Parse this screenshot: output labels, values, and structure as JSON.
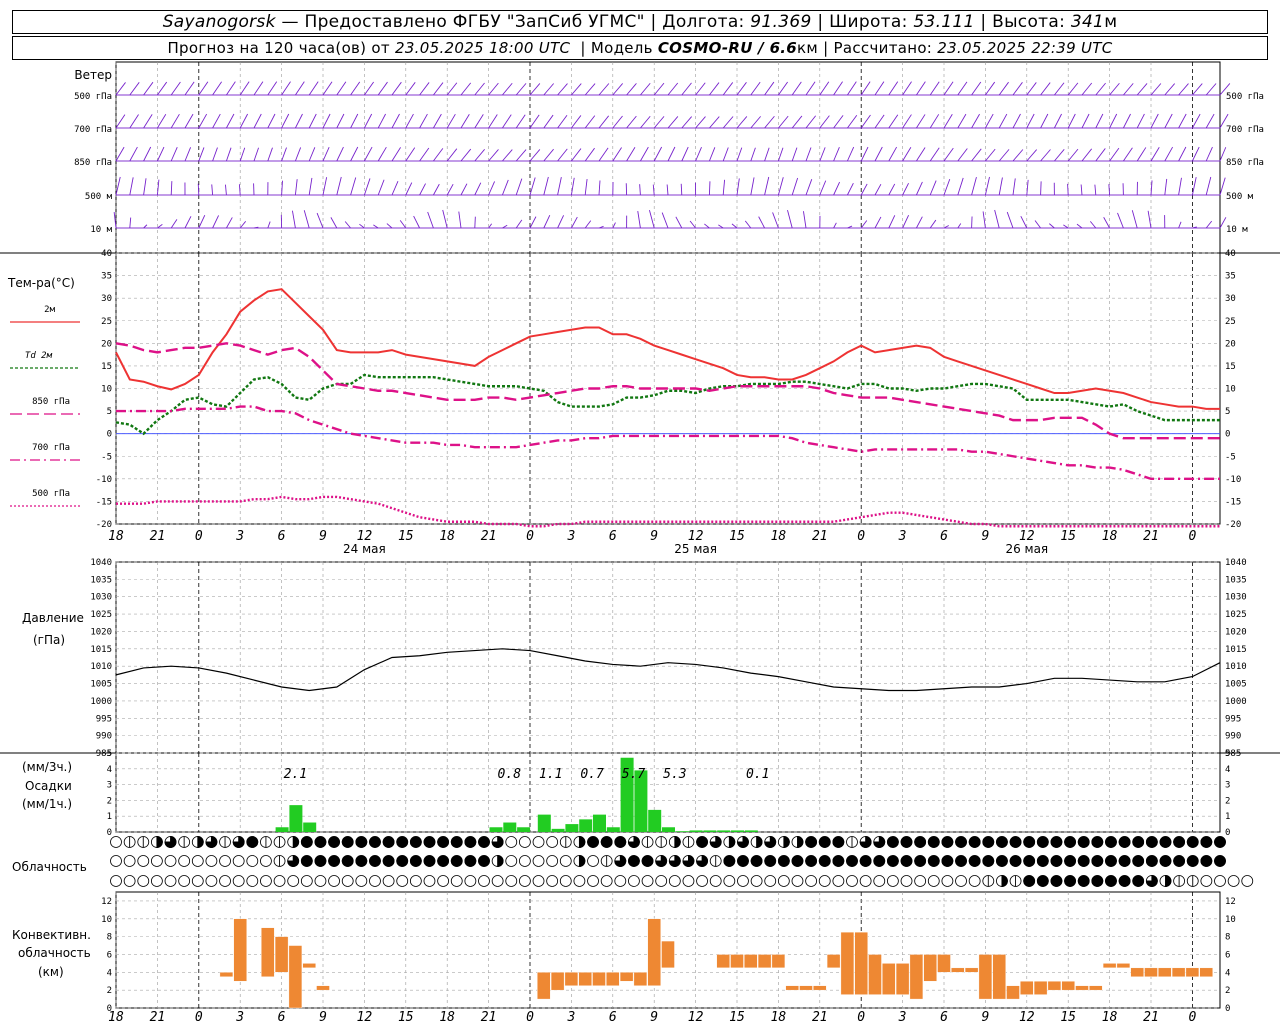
{
  "header": {
    "station": "Sayanogorsk",
    "dash": "—",
    "provider": "Предоставлено ФГБУ \"ЗапСиб УГМС\"",
    "lon_label": "Долгота:",
    "lon_value": "91.369",
    "lat_label": "Широта:",
    "lat_value": "53.111",
    "alt_label": "Высота:",
    "alt_value": "341",
    "alt_unit": "м",
    "sep": "|"
  },
  "subheader": {
    "forecast_prefix": "Прогноз на 120 часа(ов) от",
    "start_time": "23.05.2025 18:00 UTC",
    "model_label": "Модель",
    "model_name": "COSMO-RU / 6.6",
    "model_unit": "км",
    "calc_label": "Рассчитано:",
    "calc_time": "23.05.2025 22:39 UTC",
    "sep": "|"
  },
  "x_axis": {
    "hour_labels": [
      "18",
      "21",
      "0",
      "3",
      "6",
      "9",
      "12",
      "15",
      "18",
      "21",
      "0",
      "3",
      "6",
      "9",
      "12",
      "15",
      "18",
      "21",
      "0",
      "3",
      "6",
      "9",
      "12",
      "15",
      "18",
      "21",
      "0"
    ],
    "day_labels": [
      {
        "text": "24 мая",
        "x": 18
      },
      {
        "text": "25 мая",
        "x": 42
      },
      {
        "text": "26 мая",
        "x": 66
      }
    ]
  },
  "wind": {
    "title": "Ветер",
    "levels": [
      "500 гПа",
      "700 гПа",
      "850 гПа",
      "500 м",
      "10 м"
    ],
    "right_levels": [
      "500 гПа",
      "700 гПа",
      "850 гПа",
      "500 м",
      "10 м"
    ]
  },
  "temperature": {
    "title": "Тем-ра(°C)",
    "legend": [
      {
        "label": "2м",
        "color": "#ee3333",
        "dash": ""
      },
      {
        "label": "Td 2м",
        "color": "#117711",
        "dash": "3,2"
      },
      {
        "label": "850 гПа",
        "color": "#dd1188",
        "dash": "12,5"
      },
      {
        "label": "700 гПа",
        "color": "#dd1188",
        "dash": "10,4,2,4"
      },
      {
        "label": "500 гПа",
        "color": "#dd1188",
        "dash": "2,2"
      }
    ]
  },
  "pressure": {
    "title": "Давление",
    "unit": "(гПа)"
  },
  "precip": {
    "title1": "(мм/3ч.)",
    "title2": "Осадки",
    "title3": "(мм/1ч.)"
  },
  "clouds": {
    "title": "Облачность"
  },
  "convective": {
    "title1": "Конвективн.",
    "title2": "облачность",
    "title3": "(км)"
  },
  "chart_data": [
    {
      "type": "line",
      "title": "Тем-ра(°C)",
      "x": [
        0,
        1,
        2,
        3,
        4,
        5,
        6,
        7,
        8,
        9,
        10,
        11,
        12,
        13,
        14,
        15,
        16,
        17,
        18,
        19,
        20,
        21,
        22,
        23,
        24,
        25,
        26,
        27,
        28,
        29,
        30,
        31,
        32,
        33,
        34,
        35,
        36,
        37,
        38,
        39,
        40,
        41,
        42,
        43,
        44,
        45,
        46,
        47,
        48,
        49,
        50,
        51,
        52,
        53,
        54,
        55,
        56,
        57,
        58,
        59,
        60,
        61,
        62,
        63,
        64,
        65,
        66,
        67,
        68,
        69,
        70,
        71,
        72,
        73,
        74,
        75,
        76,
        77,
        78,
        79,
        80
      ],
      "ylim": [
        -20,
        40
      ],
      "series": [
        {
          "name": "2м",
          "values": [
            18,
            12,
            11.5,
            10.5,
            9.8,
            11,
            13,
            18,
            22,
            27,
            29.5,
            31.5,
            32,
            29,
            26,
            23,
            18.5,
            18,
            18,
            18,
            18.5,
            17.5,
            17,
            16.5,
            16,
            15.5,
            15,
            17,
            18.5,
            20,
            21.5,
            22,
            22.5,
            23,
            23.5,
            23.5,
            22,
            22,
            21,
            19.5,
            18.5,
            17.5,
            16.5,
            15.5,
            14.5,
            13,
            12.5,
            12.5,
            12,
            12,
            13,
            14.5,
            16,
            18,
            19.5,
            18,
            18.5,
            19,
            19.5,
            19,
            17,
            16,
            15,
            14,
            13,
            12,
            11,
            10,
            9,
            9,
            9.5,
            10,
            9.5,
            9,
            8,
            7,
            6.5,
            6,
            6,
            5.5,
            5.5
          ]
        },
        {
          "name": "Td 2м",
          "values": [
            2.5,
            2,
            0,
            3,
            5,
            7.5,
            8,
            6.5,
            6,
            9,
            12,
            12.5,
            11,
            8,
            7.5,
            10,
            11,
            11,
            13,
            12.5,
            12.5,
            12.5,
            12.5,
            12.5,
            12,
            11.5,
            11,
            10.5,
            10.5,
            10.5,
            10,
            9.5,
            7,
            6,
            6,
            6,
            6.5,
            8,
            8,
            8.5,
            9.5,
            9.5,
            9,
            10,
            10.5,
            10.5,
            11,
            11,
            11,
            11.5,
            11.5,
            11,
            10.5,
            10,
            11,
            11,
            10,
            10,
            9.5,
            10,
            10,
            10.5,
            11,
            11,
            10.5,
            10,
            7.5,
            7.5,
            7.5,
            7.5,
            7,
            6.5,
            6,
            6.5,
            5,
            4,
            3,
            3,
            3,
            3,
            3
          ]
        },
        {
          "name": "850 гПа",
          "values": [
            20,
            19.5,
            18.5,
            18,
            18.5,
            19,
            19,
            19.5,
            20,
            19.5,
            18.5,
            17.5,
            18.5,
            19,
            17,
            14,
            11,
            10.5,
            10,
            9.5,
            9.5,
            9,
            8.5,
            8,
            7.5,
            7.5,
            7.5,
            8,
            8,
            7.5,
            8,
            8.5,
            9,
            9.5,
            10,
            10,
            10.5,
            10.5,
            10,
            10,
            10,
            10,
            10,
            9.5,
            10,
            10.5,
            10.5,
            10.5,
            10.5,
            10.5,
            10.5,
            10,
            9,
            8.5,
            8,
            8,
            8,
            7.5,
            7,
            6.5,
            6,
            5.5,
            5,
            4.5,
            4,
            3,
            3,
            3,
            3.5,
            3.5,
            3.5,
            2,
            0,
            -1,
            -1,
            -1,
            -1,
            -1,
            -1,
            -1,
            -1
          ]
        },
        {
          "name": "700 гПа",
          "values": [
            5,
            5,
            5,
            5,
            5,
            5.5,
            5.5,
            5.5,
            5.5,
            6,
            6,
            5,
            5,
            4.5,
            3,
            2,
            1,
            0,
            -0.5,
            -1,
            -1.5,
            -2,
            -2,
            -2,
            -2.5,
            -2.5,
            -3,
            -3,
            -3,
            -3,
            -2.5,
            -2,
            -1.5,
            -1.5,
            -1,
            -1,
            -0.5,
            -0.5,
            -0.5,
            -0.5,
            -0.5,
            -0.5,
            -0.5,
            -0.5,
            -0.5,
            -0.5,
            -0.5,
            -0.5,
            -0.5,
            -1,
            -2,
            -2.5,
            -3,
            -3.5,
            -4,
            -3.5,
            -3.5,
            -3.5,
            -3.5,
            -3.5,
            -3.5,
            -3.5,
            -4,
            -4,
            -4.5,
            -5,
            -5.5,
            -6,
            -6.5,
            -7,
            -7,
            -7.5,
            -7.5,
            -8,
            -9,
            -10,
            -10,
            -10,
            -10,
            -10,
            -10
          ]
        },
        {
          "name": "500 гПа",
          "values": [
            -15.5,
            -15.5,
            -15.5,
            -15,
            -15,
            -15,
            -15,
            -15,
            -15,
            -15,
            -14.5,
            -14.5,
            -14,
            -14.5,
            -14.5,
            -14,
            -14,
            -14.5,
            -15,
            -15.5,
            -16.5,
            -17.5,
            -18.5,
            -19,
            -19.5,
            -19.5,
            -19.5,
            -20,
            -20,
            -20,
            -20.5,
            -20.5,
            -20,
            -20,
            -19.5,
            -19.5,
            -19.5,
            -19.5,
            -19.5,
            -19.5,
            -19.5,
            -19.5,
            -19.5,
            -19.5,
            -19.5,
            -19.5,
            -19.5,
            -19.5,
            -19.5,
            -19.5,
            -19.5,
            -19.5,
            -19.5,
            -19,
            -18.5,
            -18,
            -17.5,
            -17.5,
            -18,
            -18.5,
            -19,
            -19.5,
            -20,
            -20,
            -20.5,
            -20.5,
            -20.5,
            -20.5,
            -20.5,
            -20.5,
            -20.5,
            -20.5,
            -20.5,
            -20.5,
            -20.5,
            -20.5,
            -20.5,
            -20.5,
            -20.5,
            -20.5,
            -20.5
          ]
        }
      ]
    },
    {
      "type": "line",
      "title": "Давление",
      "ylabel": "(гПа)",
      "x": [
        0,
        2,
        4,
        6,
        8,
        10,
        12,
        14,
        16,
        18,
        20,
        22,
        24,
        26,
        28,
        30,
        32,
        34,
        36,
        38,
        40,
        42,
        44,
        46,
        48,
        50,
        52,
        54,
        56,
        58,
        60,
        62,
        64,
        66,
        68,
        70,
        72,
        74,
        76,
        78,
        80
      ],
      "ylim": [
        985,
        1040
      ],
      "series": [
        {
          "name": "",
          "values": [
            1007.5,
            1009.5,
            1010,
            1009.5,
            1008,
            1006,
            1004,
            1003,
            1004,
            1009,
            1012.5,
            1013,
            1014,
            1014.5,
            1015,
            1014.5,
            1013,
            1011.5,
            1010.5,
            1010,
            1011,
            1010.5,
            1009.5,
            1008,
            1007,
            1005.5,
            1004,
            1003.5,
            1003,
            1003,
            1003.5,
            1004,
            1004,
            1005,
            1006.5,
            1006.5,
            1006,
            1005.5,
            1005.5,
            1007,
            1011
          ]
        }
      ]
    },
    {
      "type": "bar",
      "title": "Осадки",
      "ylabel": "(мм/1ч.)",
      "ylim": [
        0,
        5
      ],
      "x_hours": [
        12,
        13,
        14,
        27.5,
        28.5,
        29.5,
        31,
        32,
        33,
        34,
        35,
        36,
        37,
        38,
        39,
        40,
        41,
        42,
        43,
        44,
        45,
        46
      ],
      "values": [
        0.3,
        1.7,
        0.6,
        0.3,
        0.6,
        0.3,
        1.1,
        0.2,
        0.5,
        0.8,
        1.1,
        0.3,
        4.7,
        3.9,
        1.4,
        0.3,
        0.05,
        0.1,
        0.1,
        0.1,
        0.1,
        0.1
      ],
      "labels_3h": [
        {
          "x": 13,
          "text": "2.1"
        },
        {
          "x": 28.5,
          "text": "0.8"
        },
        {
          "x": 31.5,
          "text": "1.1"
        },
        {
          "x": 34.5,
          "text": "0.7"
        },
        {
          "x": 37.5,
          "text": "5.7"
        },
        {
          "x": 40.5,
          "text": "5.3"
        },
        {
          "x": 46.5,
          "text": "0.1"
        }
      ]
    },
    {
      "type": "table",
      "title": "Облачность",
      "rows": [
        [
          0,
          1,
          1,
          2,
          3,
          1,
          2,
          3,
          1,
          3,
          4,
          1,
          1,
          2,
          4,
          4,
          4,
          4,
          4,
          4,
          4,
          4,
          4,
          4,
          4,
          4,
          4,
          4,
          3,
          0,
          0,
          0,
          0,
          1,
          2,
          4,
          4,
          4,
          3,
          1,
          1,
          2,
          1,
          4,
          3,
          2,
          3,
          2,
          3,
          2,
          2,
          4,
          4,
          4,
          1,
          3,
          3,
          4,
          4,
          4,
          4,
          4,
          4,
          4,
          4,
          4,
          4,
          4,
          4,
          4,
          4,
          4,
          4,
          4,
          4,
          4,
          4,
          4,
          4,
          4,
          4,
          4
        ],
        [
          0,
          0,
          0,
          0,
          0,
          0,
          0,
          0,
          0,
          0,
          0,
          0,
          1,
          3,
          4,
          4,
          4,
          4,
          4,
          4,
          4,
          4,
          4,
          4,
          4,
          4,
          4,
          4,
          2,
          0,
          0,
          0,
          0,
          0,
          2,
          0,
          1,
          3,
          4,
          4,
          3,
          3,
          3,
          3,
          1,
          4,
          4,
          4,
          4,
          4,
          4,
          4,
          4,
          4,
          4,
          4,
          4,
          4,
          4,
          4,
          4,
          4,
          4,
          4,
          4,
          4,
          4,
          4,
          4,
          4,
          4,
          4,
          4,
          4,
          4,
          4,
          4,
          4,
          4,
          4,
          4,
          4
        ],
        [
          0,
          0,
          0,
          0,
          0,
          0,
          0,
          0,
          0,
          0,
          0,
          0,
          0,
          0,
          0,
          0,
          0,
          0,
          0,
          0,
          0,
          0,
          0,
          0,
          0,
          0,
          0,
          0,
          0,
          0,
          0,
          0,
          0,
          0,
          0,
          0,
          0,
          0,
          0,
          0,
          0,
          0,
          0,
          0,
          0,
          0,
          0,
          0,
          0,
          0,
          0,
          0,
          0,
          0,
          0,
          0,
          0,
          0,
          0,
          0,
          0,
          0,
          0,
          0,
          1,
          2,
          1,
          4,
          4,
          4,
          4,
          4,
          4,
          4,
          4,
          4,
          3,
          2,
          1,
          1,
          0,
          0,
          0,
          0
        ]
      ]
    },
    {
      "type": "bar",
      "title": "Конвективн. облачность",
      "ylabel": "(км)",
      "ylim": [
        0,
        13
      ],
      "x_hours": [
        8,
        9,
        11,
        12,
        13,
        14,
        15,
        31,
        32,
        33,
        34,
        35,
        36,
        37,
        38,
        39,
        40,
        44,
        45,
        46,
        47,
        48,
        49,
        50,
        51,
        52,
        53,
        54,
        55,
        56,
        57,
        58,
        59,
        60,
        61,
        62,
        63,
        64,
        65,
        66,
        67,
        68,
        69,
        70,
        71,
        72,
        73,
        74,
        75,
        76,
        77,
        78,
        79
      ],
      "bottom": [
        3.5,
        3,
        3.5,
        4,
        0,
        4.5,
        2,
        1,
        2,
        2.5,
        2.5,
        2.5,
        2.5,
        3,
        2.5,
        2.5,
        4.5,
        4.5,
        4.5,
        4.5,
        4.5,
        4.5,
        2,
        2,
        2,
        4.5,
        1.5,
        1.5,
        1.5,
        1.5,
        1.5,
        1,
        3,
        4,
        4,
        4,
        1,
        1,
        1,
        1.5,
        1.5,
        2,
        2,
        2,
        2,
        4.5,
        4.5,
        3.5,
        3.5,
        3.5,
        3.5,
        3.5,
        3.5
      ],
      "top": [
        4,
        10,
        9,
        8,
        7,
        5,
        2.5,
        4,
        4,
        4,
        4,
        4,
        4,
        4,
        4,
        10,
        7.5,
        6,
        6,
        6,
        6,
        6,
        2.5,
        2.5,
        2.5,
        6,
        8.5,
        8.5,
        6,
        5,
        5,
        6,
        6,
        6,
        4.5,
        4.5,
        6,
        6,
        2.5,
        3,
        3,
        3,
        3,
        2.5,
        2.5,
        5,
        5,
        4.5,
        4.5,
        4.5,
        4.5,
        4.5,
        4.5
      ]
    }
  ]
}
